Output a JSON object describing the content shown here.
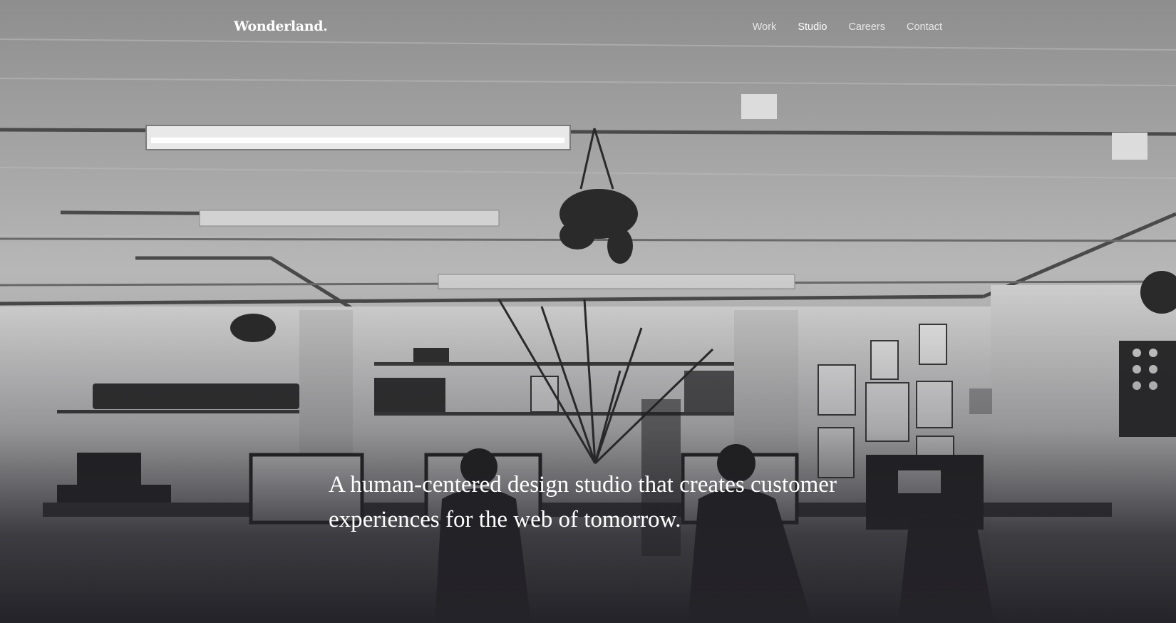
{
  "brand": {
    "logo_text": "Wonderland."
  },
  "nav": {
    "items": [
      {
        "label": "Work",
        "active": false
      },
      {
        "label": "Studio",
        "active": true
      },
      {
        "label": "Careers",
        "active": false
      },
      {
        "label": "Contact",
        "active": false
      }
    ]
  },
  "hero": {
    "headline": "A human-centered design studio that creates customer experiences for the web of tomorrow.",
    "background": "grayscale photo of studio office interior with desks, monitors and plants"
  },
  "colors": {
    "text": "#ffffff",
    "nav_inactive": "rgba(255,255,255,0.78)",
    "overlay_dark": "#242329"
  }
}
